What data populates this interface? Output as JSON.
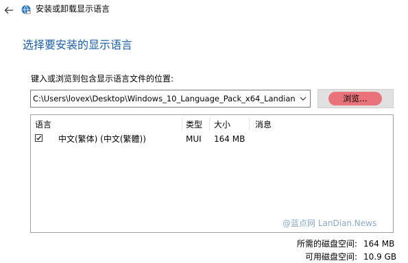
{
  "window": {
    "title": "安装或卸载显示语言",
    "icons": {
      "back": "back-arrow-icon",
      "app": "globe-language-icon"
    }
  },
  "heading": "选择要安装的显示语言",
  "path": {
    "label": "键入或浏览到包含显示语言文件的位置:",
    "value": "C:\\Users\\lovex\\Desktop\\Windows_10_Language_Pack_x64_Landian",
    "browse_label": "浏览..."
  },
  "languages": {
    "columns": [
      "语言",
      "类型",
      "大小",
      "消息"
    ],
    "rows": [
      {
        "checked": true,
        "language": "中文(繁体) (中文(繁體))",
        "type": "MUI",
        "size": "164 MB",
        "message": ""
      }
    ]
  },
  "watermark": "@蓝点网 LanDian.News",
  "disk": {
    "required_label": "所需的磁盘空间:",
    "required_value": "164 MB",
    "available_label": "可用磁盘空间:",
    "available_value": "10.9 GB"
  },
  "colors": {
    "heading": "#1a5ea8",
    "browse_highlight": "#e8737a"
  }
}
